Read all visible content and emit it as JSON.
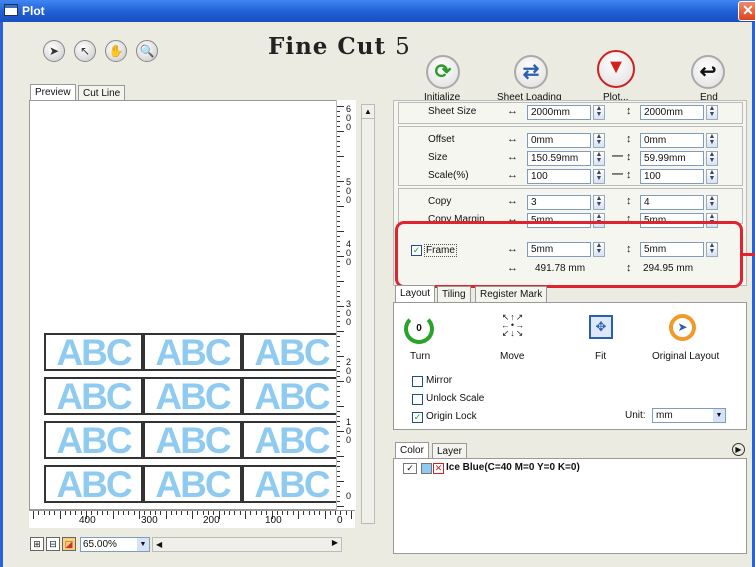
{
  "window": {
    "title": "Plot",
    "close": "✕"
  },
  "toolbar": {
    "tools": [
      {
        "name": "select-tool",
        "glyph": "➤"
      },
      {
        "name": "pointer-tool",
        "glyph": "↖"
      },
      {
        "name": "hand-tool",
        "glyph": "✋"
      },
      {
        "name": "zoom-tool",
        "glyph": "🔍"
      }
    ]
  },
  "logo": {
    "main": "Fine Cut",
    "version": "5"
  },
  "actions": {
    "initialize": "Initialize",
    "sheet_loading": "Sheet Loading",
    "plot": "Plot...",
    "end": "End"
  },
  "preview": {
    "tabs": [
      "Preview",
      "Cut Line"
    ],
    "cell_text": "ABC",
    "zoom": "65.00%",
    "hruler": [
      "400",
      "300",
      "200",
      "100",
      "0"
    ],
    "vruler": [
      "6\n0\n0",
      "5\n0\n0",
      "4\n0\n0",
      "3\n0\n0",
      "2\n0\n0",
      "1\n0\n0",
      "0"
    ]
  },
  "settings": {
    "sheet_size": {
      "label": "Sheet Size",
      "w": "2000mm",
      "h": "2000mm"
    },
    "offset": {
      "label": "Offset",
      "w": "0mm",
      "h": "0mm"
    },
    "size": {
      "label": "Size",
      "w": "150.59mm",
      "h": "59.99mm"
    },
    "scale": {
      "label": "Scale(%)",
      "w": "100",
      "h": "100"
    },
    "copy": {
      "label": "Copy",
      "w": "3",
      "h": "4"
    },
    "copy_margin": {
      "label": "Copy Margin",
      "w": "5mm",
      "h": "5mm"
    },
    "frame": {
      "label": "Frame",
      "checked": "✓",
      "w": "5mm",
      "h": "5mm",
      "total_w": "491.78 mm",
      "total_h": "294.95 mm"
    }
  },
  "layout": {
    "tabs": [
      "Layout",
      "Tiling",
      "Register Mark"
    ],
    "turn": "Turn",
    "move": "Move",
    "fit": "Fit",
    "original": "Original Layout",
    "mirror": "Mirror",
    "unlock_scale": "Unlock Scale",
    "origin_lock": "Origin Lock",
    "unit_label": "Unit:",
    "unit": "mm",
    "check": "✓"
  },
  "color_panel": {
    "tabs": [
      "Color",
      "Layer"
    ],
    "item": "Ice Blue(C=40 M=0 Y=0 K=0)",
    "check": "✓",
    "x": "✕"
  },
  "colors": {
    "accent_red": "#e0232d",
    "ice_blue": "#8fcbf0"
  }
}
